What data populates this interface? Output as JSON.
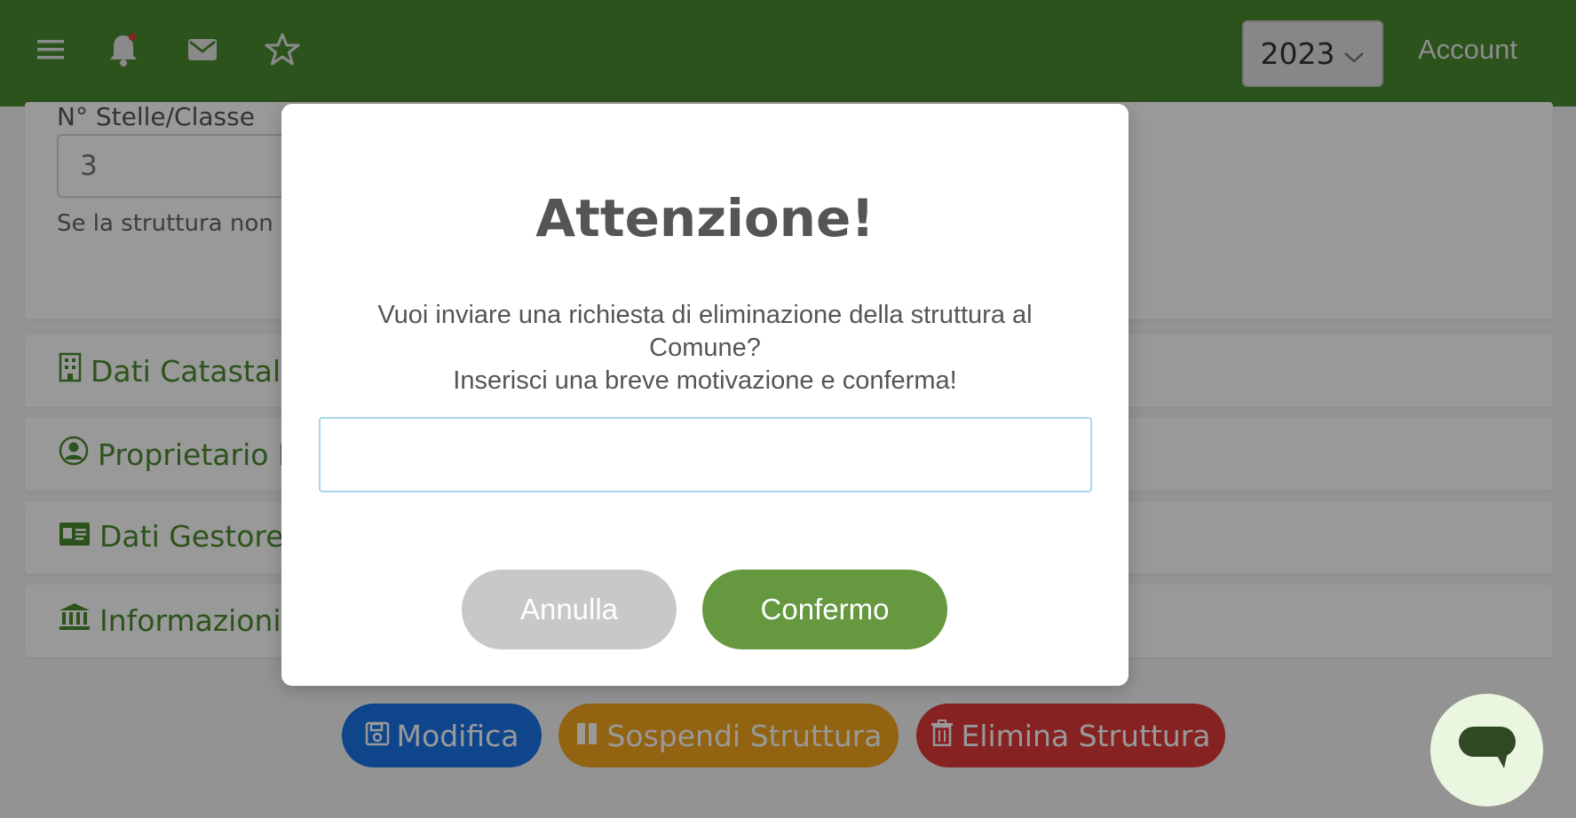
{
  "topbar": {
    "year_value": "2023",
    "account_label": "Account",
    "icons": [
      "menu-icon",
      "bell-icon",
      "mail-icon",
      "star-icon"
    ]
  },
  "background": {
    "field_label": "N° Stelle/Classe",
    "field_value": "3",
    "helper_text": "Se la struttura non h",
    "accordions": [
      {
        "label": "Dati Catastali",
        "icon": "building-icon"
      },
      {
        "label": "Proprietario I",
        "icon": "user-circle-icon"
      },
      {
        "label": "Dati Gestore",
        "icon": "id-card-icon"
      },
      {
        "label": "Informazioni",
        "icon": "bank-icon"
      }
    ],
    "actions": {
      "modifica": "Modifica",
      "sospendi": "Sospendi Struttura",
      "elimina": "Elimina Struttura"
    }
  },
  "modal": {
    "title": "Attenzione!",
    "message_line1": "Vuoi inviare una richiesta di eliminazione della struttura al Comune?",
    "message_line2": "Inserisci una breve motivazione e conferma!",
    "input_value": "",
    "cancel_label": "Annulla",
    "confirm_label": "Confermo"
  },
  "colors": {
    "brand_green": "#4c8a2f",
    "confirm_green": "#66983f",
    "modifica_blue": "#1a73e8",
    "sospendi_orange": "#f4a51d",
    "elimina_red": "#e03939"
  }
}
